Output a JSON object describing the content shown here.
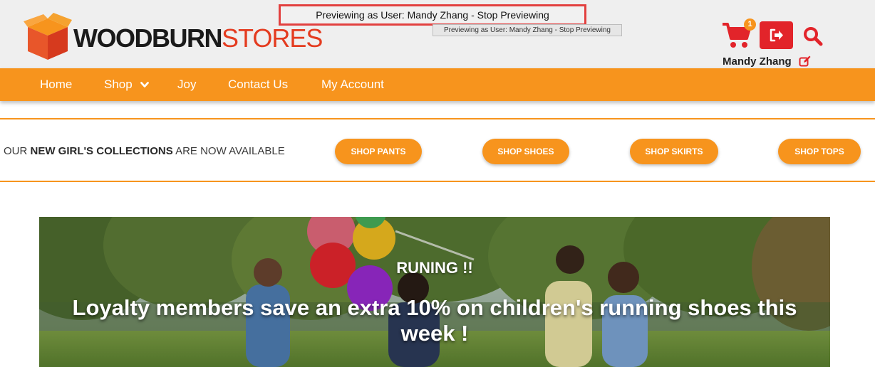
{
  "header": {
    "logo_bold": "WOODBURN",
    "logo_light": "STORES",
    "preview_banner": "Previewing as User: Mandy Zhang - Stop Previewing",
    "preview_tooltip": "Previewing as User: Mandy Zhang - Stop Previewing",
    "cart_count": "1",
    "user_name": "Mandy Zhang",
    "icons": [
      "cart-icon",
      "logout-icon",
      "search-icon",
      "edit-icon"
    ]
  },
  "nav": {
    "items": [
      "Home",
      "Shop",
      "Joy",
      "Contact Us",
      "My Account"
    ]
  },
  "promo": {
    "prefix": "OUR ",
    "highlight": "NEW GIRL'S COLLECTIONS",
    "suffix": " ARE NOW AVAILABLE",
    "buttons": [
      "SHOP PANTS",
      "SHOP SHOES",
      "SHOP SKIRTS",
      "SHOP TOPS"
    ]
  },
  "hero": {
    "kicker": "RUNING !!",
    "headline": "Loyalty members save an extra 10% on children's running shoes this week !"
  },
  "colors": {
    "accent": "#f7941d",
    "brand_red": "#e43b1f",
    "logout_red": "#e2242a",
    "header_bg": "#efefef"
  }
}
